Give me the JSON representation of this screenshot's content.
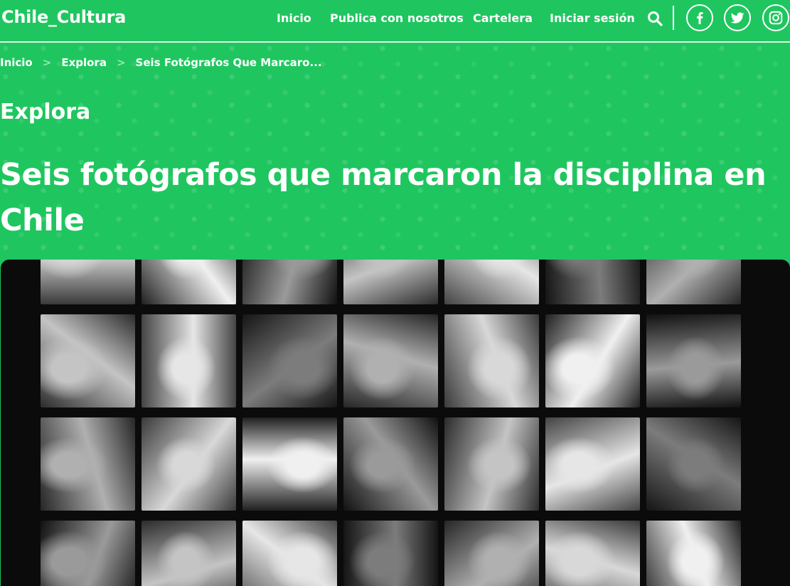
{
  "header": {
    "logo": "Chile_Cultura",
    "nav": [
      "Inicio",
      "Publica con nosotros",
      "Cartelera",
      "Iniciar sesión"
    ],
    "icons": [
      "search-icon",
      "facebook-icon",
      "twitter-icon",
      "instagram-icon"
    ]
  },
  "breadcrumb": [
    "Inicio",
    "Explora",
    "Seis Fotógrafos Que Marcaro..."
  ],
  "section": "Explora",
  "title": "Seis fotógrafos que marcaron la disciplina en Chile",
  "colors": {
    "brand_green": "#1fc65f",
    "text": "#ffffff",
    "hero_bg": "#0b0b0b"
  }
}
